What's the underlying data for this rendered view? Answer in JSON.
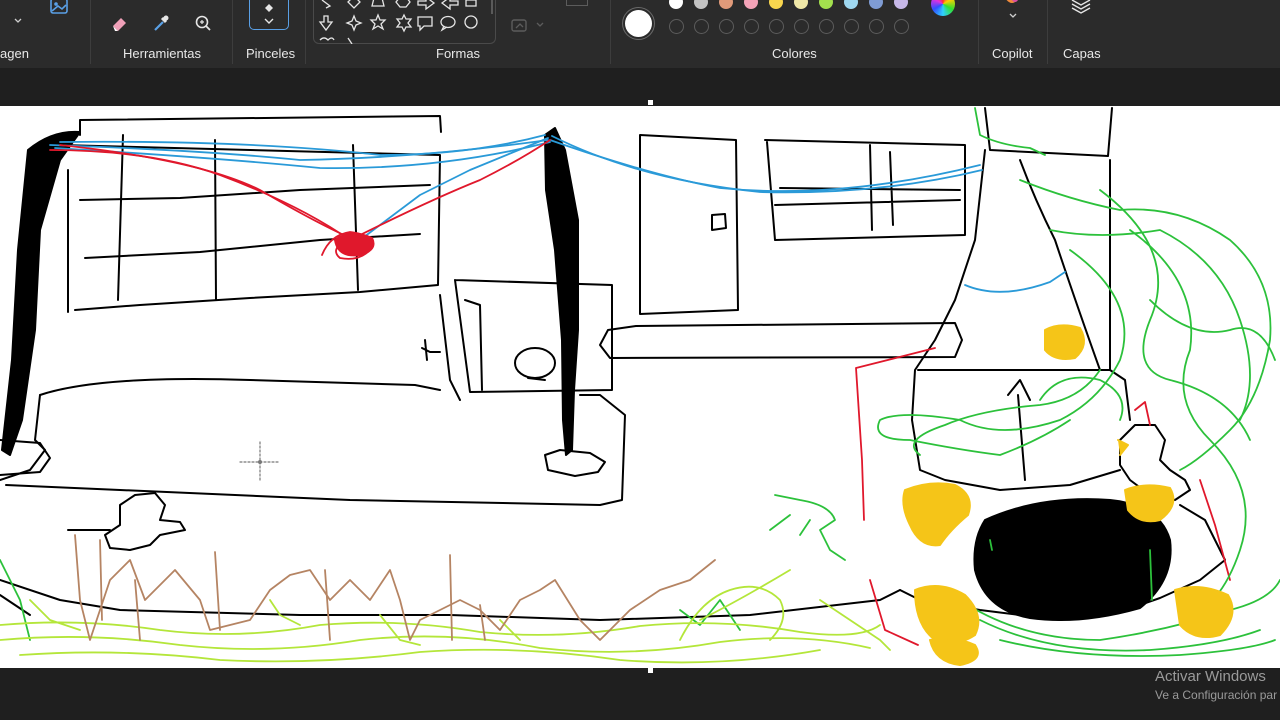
{
  "ribbon": {
    "groups": {
      "image": "agen",
      "tools": "Herramientas",
      "brushes": "Pinceles",
      "shapes": "Formas",
      "colors": "Colores",
      "copilot": "Copilot",
      "layers": "Capas"
    },
    "icons": [
      "select-image-icon",
      "eraser-icon",
      "color-picker-icon",
      "magnifier-icon",
      "brush-icon",
      "layers-icon",
      "copilot-icon",
      "color-wheel-icon"
    ],
    "color_swatches": [
      "#ffffff",
      "#c3c3c3",
      "#e09a7a",
      "#f4a3b8",
      "#f8d64e",
      "#efe7a7",
      "#a3e04e",
      "#9fd8f0",
      "#7f9cd4",
      "#c7b8e8"
    ],
    "selected_color": "#ffffff",
    "empty_slot_count": 10
  },
  "canvas": {
    "background": "#ffffff",
    "stroke_colors": {
      "black": "#000000",
      "blue": "#2a9ad8",
      "red": "#e0182c",
      "green": "#2cc13b",
      "lime": "#b4e63a",
      "brown": "#b58463",
      "yellow": "#f5c518"
    }
  },
  "watermark": {
    "title": "Activar Windows",
    "subtitle": "Ve a Configuración par"
  }
}
